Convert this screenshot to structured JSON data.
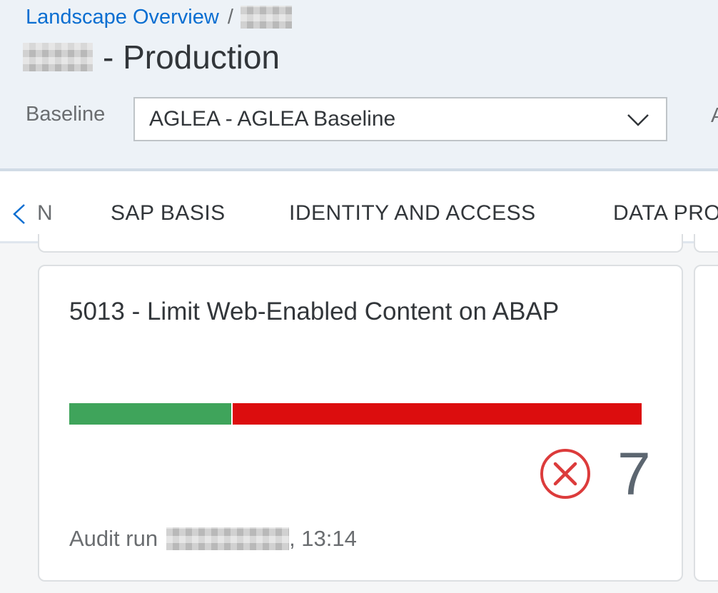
{
  "header": {
    "breadcrumb_root": "Landscape Overview",
    "breadcrumb_separator": "/",
    "title_suffix": "- Production",
    "baseline_label": "Baseline",
    "baseline_value": "AGLEA - AGLEA Baseline",
    "truncated_label": "A"
  },
  "tabs": {
    "prev_truncated": "N",
    "items": [
      {
        "label": "SAP BASIS",
        "selected": true
      },
      {
        "label": "IDENTITY AND ACCESS",
        "selected": false
      },
      {
        "label": "DATA PRO",
        "selected": false
      }
    ]
  },
  "card": {
    "title": "5013 - Limit Web-Enabled Content on ABAP",
    "progress_pass_fraction": 0.286,
    "failed_count": "7",
    "audit_label": "Audit run",
    "audit_time": ", 13:14"
  },
  "icons": {
    "tab_prev": "chevron-left-icon",
    "select_arrow": "chevron-down-icon",
    "status": "error-circle-icon"
  },
  "colors": {
    "link": "#0a6ed1",
    "tab_selected": "#2a6ebb",
    "pass": "#3fa45b",
    "fail": "#dc0d0e",
    "error_icon": "#dc3b3b"
  }
}
